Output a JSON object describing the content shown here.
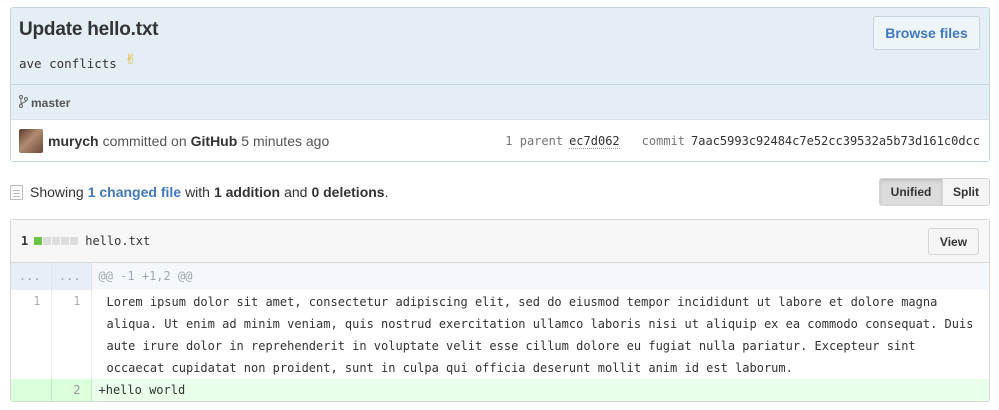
{
  "commit": {
    "title": "Update hello.txt",
    "description": "ave conflicts",
    "emoji": "✌",
    "browse_label": "Browse files",
    "branch": "master",
    "author": "murych",
    "committed_text": "committed on",
    "committer": "GitHub",
    "time": "5 minutes ago",
    "parent_label": "1 parent",
    "parent_sha": "ec7d062",
    "commit_label": "commit",
    "commit_sha": "7aac5993c92484c7e52cc39532a5b73d161c0dcc"
  },
  "toolbar": {
    "showing": "Showing",
    "changed_files": "1 changed file",
    "with": "with",
    "additions": "1 addition",
    "and": "and",
    "deletions": "0 deletions",
    "period": ".",
    "unified_label": "Unified",
    "split_label": "Split"
  },
  "file": {
    "change_count": "1",
    "diffstat": {
      "additions_blocks": 1,
      "neutral_blocks": 4
    },
    "name": "hello.txt",
    "view_label": "View",
    "hunk": {
      "old_ln": "...",
      "new_ln": "...",
      "header": "@@ -1 +1,2 @@"
    },
    "lines": [
      {
        "type": "context",
        "old_ln": "1",
        "new_ln": "1",
        "text": "Lorem ipsum dolor sit amet, consectetur adipiscing elit, sed do eiusmod tempor incididunt ut labore et dolore magna aliqua. Ut enim ad minim veniam, quis nostrud exercitation ullamco laboris nisi ut aliquip ex ea commodo consequat. Duis aute irure dolor in reprehenderit in voluptate velit esse cillum dolore eu fugiat nulla pariatur. Excepteur sint occaecat cupidatat non proident, sunt in culpa qui officia deserunt mollit anim id est laborum."
      },
      {
        "type": "addition",
        "old_ln": "",
        "new_ln": "2",
        "text": "+hello world"
      }
    ]
  },
  "colors": {
    "commit_bg": "#e3eff5",
    "link": "#4078c0",
    "addition_bg": "#eaffea",
    "addition_stat": "#6cc644"
  }
}
